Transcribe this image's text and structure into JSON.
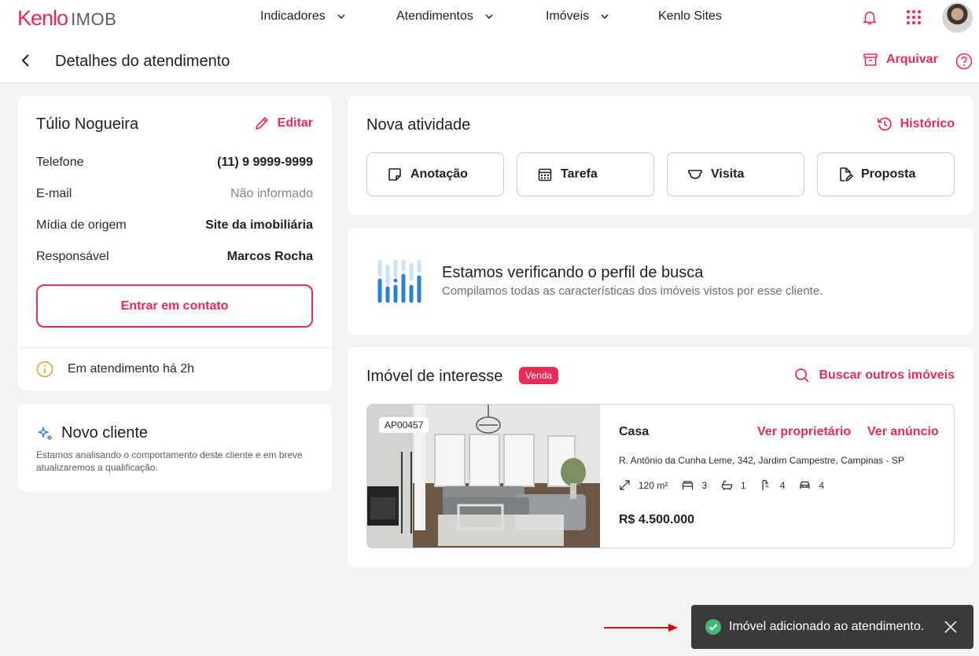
{
  "brand": {
    "name": "Kenlo",
    "product": "IMOB"
  },
  "nav": {
    "indicadores": "Indicadores",
    "atendimentos": "Atendimentos",
    "imoveis": "Imóveis",
    "sites": "Kenlo Sites"
  },
  "header": {
    "title": "Detalhes do atendimento",
    "archive": "Arquivar"
  },
  "client": {
    "name": "Túlio Nogueira",
    "edit": "Editar",
    "fields": [
      {
        "label": "Telefone",
        "value": "(11) 9 9999-9999"
      },
      {
        "label": "E-mail",
        "value": "Não informado"
      },
      {
        "label": "Mídia de origem",
        "value": "Site da imobiliária"
      },
      {
        "label": "Responsável",
        "value": "Marcos Rocha"
      }
    ],
    "contact_button": "Entrar em contato",
    "status": "Em atendimento há 2h"
  },
  "new_client": {
    "title": "Novo cliente",
    "description": "Estamos analisando o comportamento deste cliente e em breve atualizaremos a qualificação."
  },
  "activity": {
    "title": "Nova atividade",
    "history": "Histórico",
    "buttons": [
      "Anotação",
      "Tarefa",
      "Visita",
      "Proposta"
    ]
  },
  "profile": {
    "heading": "Estamos verificando o perfil de busca",
    "subheading": "Compilamos todas as características dos imóveis vistos por esse cliente."
  },
  "interest": {
    "title": "Imóvel de interesse",
    "badge": "Venda",
    "search": "Buscar outros imóveis",
    "property": {
      "code": "AP00457",
      "type": "Casa",
      "owner_link": "Ver proprietário",
      "ad_link": "Ver anúncio",
      "address": "R. Antônio da Cunha Leme, 342, Jardim Campestre, Campinas - SP",
      "area": "120 m²",
      "bedrooms": "3",
      "bathrooms": "1",
      "showers": "4",
      "parking": "4",
      "price": "R$ 4.500.000"
    }
  },
  "toast": {
    "message": "Imóvel adicionado ao atendimento."
  },
  "colors": {
    "accent": "#ea2a57",
    "toast_bg": "#3a3a3d",
    "success": "#3fb873",
    "info": "#d9a23a",
    "annotation_arrow": "#e00000"
  }
}
